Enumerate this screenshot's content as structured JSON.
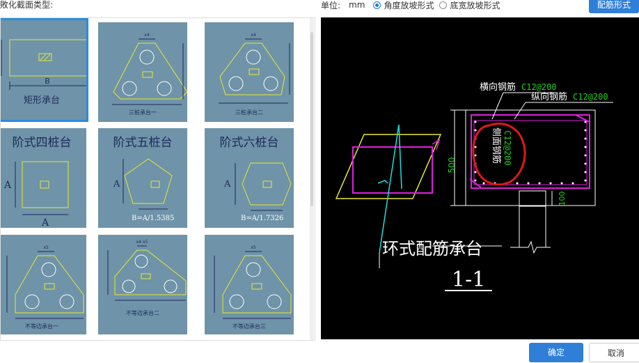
{
  "header": {
    "section_label": "敗化截面类型:",
    "unit_label": "单位:",
    "unit_value": "mm",
    "radio_options": [
      {
        "label": "角度放坡形式",
        "selected": true
      },
      {
        "label": "底宽放坡形式",
        "selected": false
      }
    ],
    "rebar_button": "配筋形式"
  },
  "gallery": {
    "cells": [
      {
        "caption": "矩形承台",
        "dim_b": "B",
        "selected": true
      },
      {
        "caption": "三桩承台一",
        "dim_top": "x4",
        "y_labels": [
          "y3",
          "y2",
          "y1"
        ],
        "x_labels": [
          "x1",
          "x2",
          "x3"
        ]
      },
      {
        "caption": "三桩承台二",
        "dim_top": "x4",
        "y_labels": [
          "y3",
          "y2",
          "y1"
        ],
        "x_labels": [
          "x1",
          "x2",
          "x3"
        ]
      },
      {
        "caption": "阶式四桩台",
        "dim_a_side": "A",
        "dim_a_bottom": "A"
      },
      {
        "caption": "阶式五桩台",
        "dim_a_side": "A",
        "formula": "B=A/1.5385"
      },
      {
        "caption": "阶式六桩台",
        "dim_a_side": "A",
        "formula": "B=A/1.7326"
      },
      {
        "caption": "不等边承台一",
        "dim_top": "x5",
        "y_labels": [
          "y4",
          "y3",
          "y2",
          "y1"
        ],
        "x_labels": [
          "x1",
          "x2",
          "x3",
          "x4"
        ]
      },
      {
        "caption": "不等边承台二",
        "dim_top": "x4 x5",
        "y_labels": [
          "y5",
          "y4",
          "y3",
          "y2",
          "y1"
        ],
        "x_labels": [
          "x1",
          "x2",
          "x3"
        ]
      },
      {
        "caption": "不等边承台三",
        "dim_top": "x5",
        "y_labels": [
          "y4",
          "y3",
          "y2",
          "y1"
        ],
        "x_labels": [
          "x1",
          "x2",
          "x3",
          "x4"
        ]
      }
    ]
  },
  "preview": {
    "label_horizontal": "横向钢筋",
    "value_horizontal": "C12@200",
    "label_longitudinal": "纵向钢筋",
    "value_longitudinal": "C12@200",
    "label_side": "侧面钢筋",
    "value_side": "C12@200",
    "dim_height": "500",
    "dim_pile": "100",
    "title": "环式配筋承台",
    "section": "1-1"
  },
  "footer": {
    "ok_button": "确定",
    "cancel_button": "取消"
  },
  "colors": {
    "accent": "#2f7fd8",
    "cell_bg": "#6f93a8",
    "cad_yellow": "#e8e832",
    "cad_magenta": "#e020e0",
    "cad_cyan": "#20e0e0",
    "cad_green": "#20d020",
    "annotation_red": "#e01818"
  }
}
